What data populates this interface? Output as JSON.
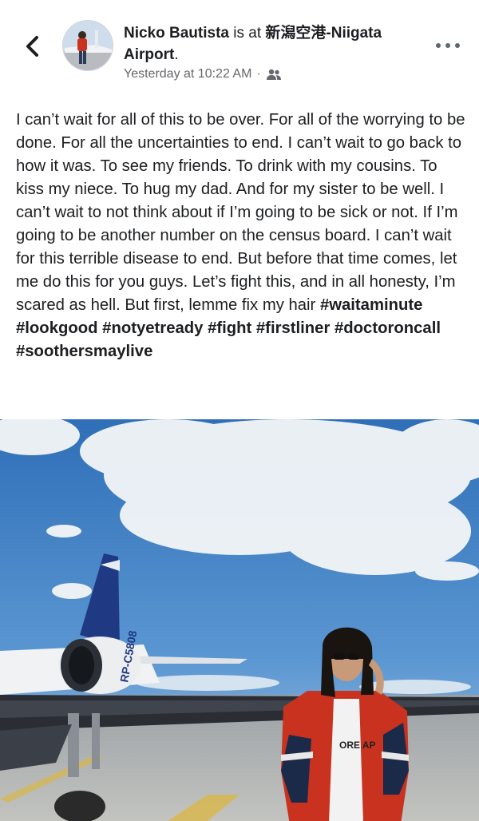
{
  "header": {
    "author_name": "Nicko Bautista",
    "is_at": " is at ",
    "location": "新潟空港-Niigata Airport",
    "location_suffix": ".",
    "timestamp": "Yesterday at 10:22 AM",
    "separator": "·",
    "privacy_icon": "friends-icon",
    "back_icon": "chevron-left-icon",
    "more_icon": "more-horizontal-icon"
  },
  "post": {
    "body": "I can’t wait for all of this to be over. For all of the worrying to be done. For all the uncertainties to end. I can’t wait to go back to how it was. To see my friends. To drink with my cousins. To kiss my niece. To hug my dad. And for my sister to be well. I can’t wait to not think about if I’m going to be sick or not. If I’m going to be another number on the census board. I can’t wait for this terrible disease to end. But before that time comes, let me do this for you guys. Let’s fight this, and in all honesty, I’m scared as hell. But first, lemme fix my hair ",
    "hashtags": [
      "#waitaminute",
      "#lookgood",
      "#notyetready",
      "#fight",
      "#firstliner",
      "#doctoroncall",
      "#soothersmaylive"
    ]
  },
  "photo": {
    "aircraft_registration": "RP-C5808",
    "jacket_text": "ORE AP"
  },
  "colors": {
    "text": "#1c1e21",
    "meta": "#65676b",
    "sky": "#3f7fc4",
    "jacket_red": "#c8321f",
    "jacket_navy": "#1c2a4a"
  }
}
